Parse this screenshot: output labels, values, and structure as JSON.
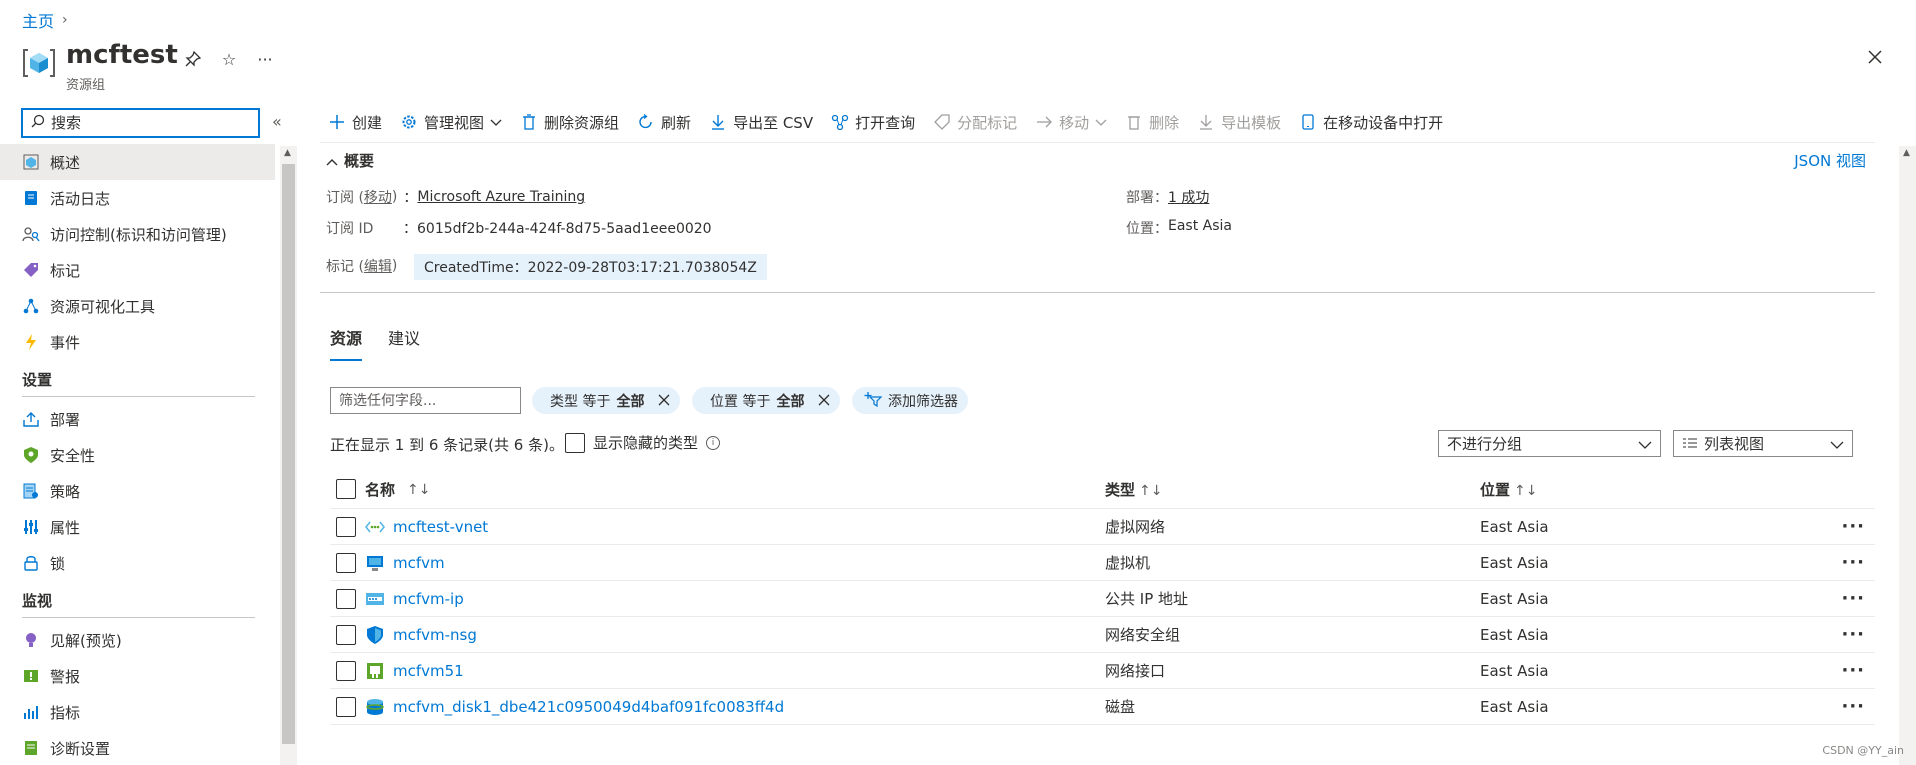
{
  "breadcrumb": {
    "home": "主页"
  },
  "header": {
    "title": "mcftest",
    "subtitle": "资源组"
  },
  "sidebar": {
    "search_placeholder": "搜索",
    "items": [
      {
        "label": "概述",
        "icon": "overview-icon",
        "active": true
      },
      {
        "label": "活动日志",
        "icon": "activity-log-icon"
      },
      {
        "label": "访问控制(标识和访问管理)",
        "icon": "iam-icon"
      },
      {
        "label": "标记",
        "icon": "tag-icon"
      },
      {
        "label": "资源可视化工具",
        "icon": "visualizer-icon"
      },
      {
        "label": "事件",
        "icon": "events-icon"
      }
    ],
    "settings_title": "设置",
    "settings_items": [
      {
        "label": "部署",
        "icon": "deployments-icon"
      },
      {
        "label": "安全性",
        "icon": "security-icon"
      },
      {
        "label": "策略",
        "icon": "policy-icon"
      },
      {
        "label": "属性",
        "icon": "properties-icon"
      },
      {
        "label": "锁",
        "icon": "lock-icon"
      }
    ],
    "monitor_title": "监视",
    "monitor_items": [
      {
        "label": "见解(预览)",
        "icon": "insights-icon"
      },
      {
        "label": "警报",
        "icon": "alerts-icon"
      },
      {
        "label": "指标",
        "icon": "metrics-icon"
      },
      {
        "label": "诊断设置",
        "icon": "diagnostics-icon"
      }
    ]
  },
  "toolbar": {
    "create": "创建",
    "manage_view": "管理视图",
    "delete_rg": "删除资源组",
    "refresh": "刷新",
    "export_csv": "导出至 CSV",
    "open_query": "打开查询",
    "assign_tags": "分配标记",
    "move": "移动",
    "delete": "删除",
    "export_template": "导出模板",
    "open_mobile": "在移动设备中打开"
  },
  "essentials": {
    "header": "概要",
    "json_view": "JSON 视图",
    "subscription_label": "订阅 (",
    "subscription_move": "移动",
    "subscription_label_end": ")",
    "colon": "：",
    "subscription_value": "Microsoft Azure Training",
    "subscription_id_label": "订阅 ID",
    "subscription_id_value": "：6015df2b-244a-424f-8d75-5aad1eee0020",
    "tags_label": "标记 (",
    "tags_edit": "编辑",
    "tags_label_end": ")",
    "tag_value": "CreatedTime：2022-09-28T03:17:21.7038054Z",
    "deployments_label": "部署：",
    "deployments_value": "1 成功",
    "location_label": "位置：",
    "location_value": "East Asia"
  },
  "tabs": {
    "resources": "资源",
    "recommendations": "建议"
  },
  "filters": {
    "placeholder": "筛选任何字段...",
    "type_pill_prefix": "类型 等于 ",
    "type_pill_value": "全部",
    "location_pill_prefix": "位置 等于 ",
    "location_pill_value": "全部",
    "add_filter": "添加筛选器"
  },
  "records": {
    "count_text": "正在显示 1 到 6 条记录(共 6 条)。",
    "show_hidden": "显示隐藏的类型",
    "grouping": "不进行分组",
    "view": "列表视图"
  },
  "table": {
    "headers": {
      "name": "名称",
      "type": "类型",
      "location": "位置"
    },
    "rows": [
      {
        "name": "mcftest-vnet",
        "type": "虚拟网络",
        "location": "East Asia",
        "icon": "vnet-icon"
      },
      {
        "name": "mcfvm",
        "type": "虚拟机",
        "location": "East Asia",
        "icon": "vm-icon"
      },
      {
        "name": "mcfvm-ip",
        "type": "公共 IP 地址",
        "location": "East Asia",
        "icon": "public-ip-icon"
      },
      {
        "name": "mcfvm-nsg",
        "type": "网络安全组",
        "location": "East Asia",
        "icon": "nsg-icon"
      },
      {
        "name": "mcfvm51",
        "type": "网络接口",
        "location": "East Asia",
        "icon": "nic-icon"
      },
      {
        "name": "mcfvm_disk1_dbe421c0950049d4baf091fc0083ff4d",
        "type": "磁盘",
        "location": "East Asia",
        "icon": "disk-icon"
      }
    ]
  },
  "watermark": "CSDN @YY_ain",
  "colors": {
    "accent": "#0078d4",
    "pill_bg": "#e5f1fb",
    "active_nav": "#edebe9"
  }
}
